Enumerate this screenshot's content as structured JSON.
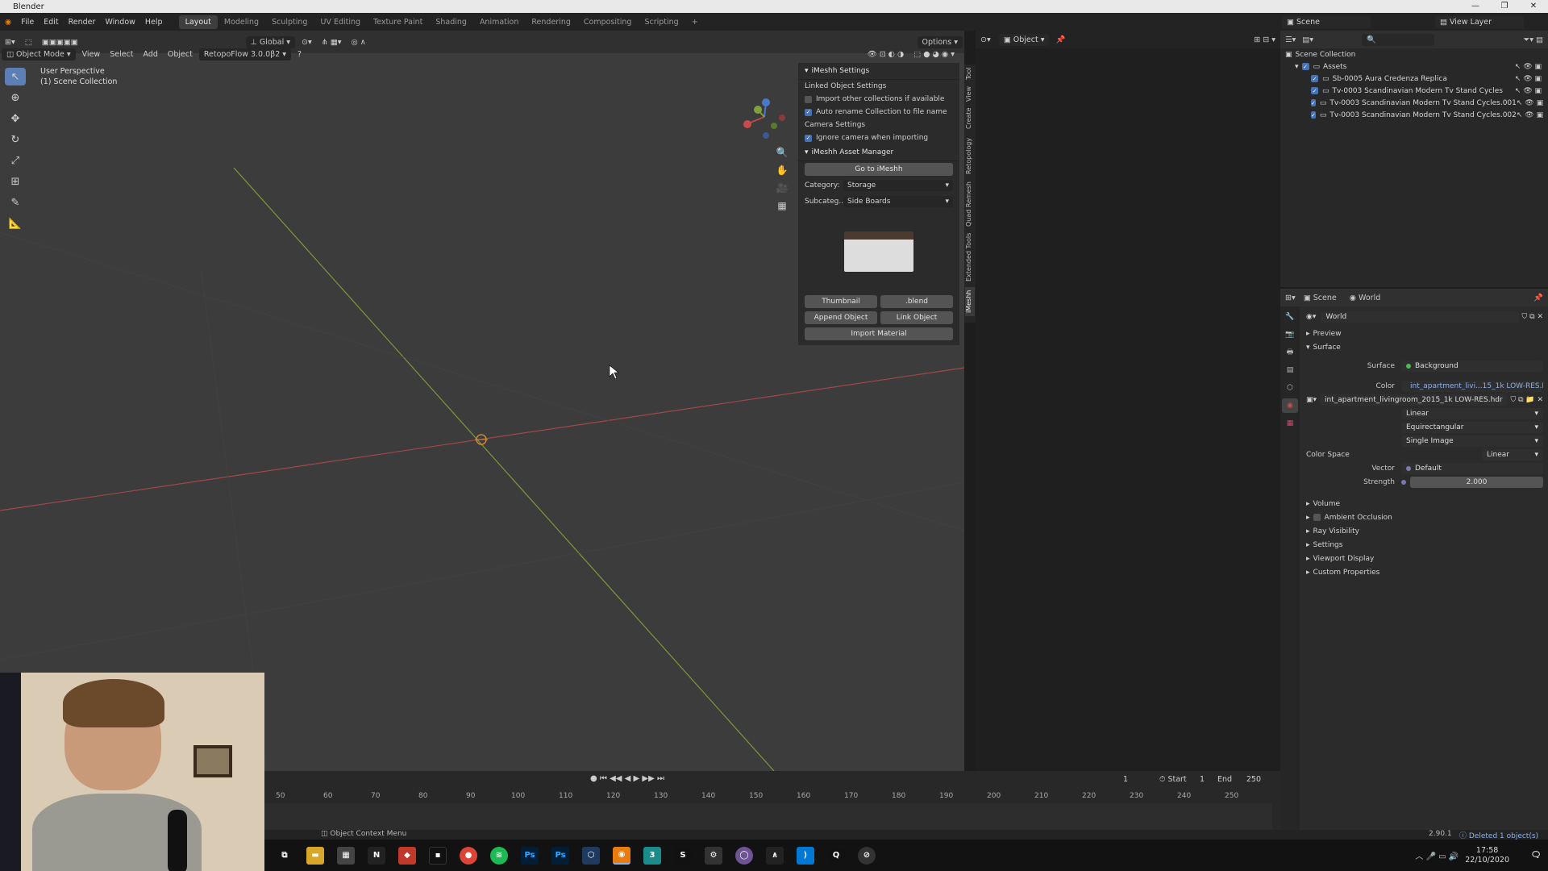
{
  "window": {
    "title": "Blender",
    "controls": [
      "—",
      "❐",
      "✕"
    ]
  },
  "menu": {
    "items": [
      "File",
      "Edit",
      "Render",
      "Window",
      "Help"
    ]
  },
  "workspaces": [
    {
      "label": "Layout",
      "active": true
    },
    {
      "label": "Modeling"
    },
    {
      "label": "Sculpting"
    },
    {
      "label": "UV Editing"
    },
    {
      "label": "Texture Paint"
    },
    {
      "label": "Shading"
    },
    {
      "label": "Animation"
    },
    {
      "label": "Rendering"
    },
    {
      "label": "Compositing"
    },
    {
      "label": "Scripting"
    },
    {
      "label": "+"
    }
  ],
  "top_right": {
    "scene": "Scene",
    "view_layer": "View Layer"
  },
  "viewport": {
    "mode": "Object Mode",
    "menus": [
      "View",
      "Select",
      "Add",
      "Object"
    ],
    "addon": "RetopoFlow 3.0.0β2",
    "transform": "Global",
    "options": "Options",
    "info_line1": "User Perspective",
    "info_line2": "(1) Scene Collection"
  },
  "npanel": {
    "imeshh_settings": "iMeshh Settings",
    "linked_object_settings": "Linked Object Settings",
    "import_other": "Import other collections if available",
    "auto_rename": "Auto rename Collection to file name",
    "camera_settings": "Camera Settings",
    "ignore_camera": "Ignore camera when importing",
    "asset_manager": "iMeshh Asset Manager",
    "go_to": "Go to iMeshh",
    "category_label": "Category:",
    "category_value": "Storage",
    "subcat_label": "Subcateg...",
    "subcat_value": "Side Boards",
    "thumbnail": "Thumbnail",
    "blend": ".blend",
    "append": "Append Object",
    "link": "Link Object",
    "import_material": "Import Material"
  },
  "vtabs": [
    "Tool",
    "View",
    "Create",
    "Retopology",
    "Quad Remesh",
    "Extended Tools",
    "iMeshh"
  ],
  "node_editor": {
    "mode": "Object"
  },
  "outliner": {
    "root": "Scene Collection",
    "collection": "Assets",
    "items": [
      "Sb-0005 Aura Credenza Replica",
      "Tv-0003 Scandinavian Modern Tv Stand Cycles",
      "Tv-0003 Scandinavian Modern Tv Stand Cycles.001",
      "Tv-0003 Scandinavian Modern Tv Stand Cycles.002"
    ]
  },
  "properties": {
    "scene": "Scene",
    "world": "World",
    "world_name": "World",
    "preview": "Preview",
    "surface": "Surface",
    "surface_label": "Surface",
    "surface_value": "Background",
    "color_label": "Color",
    "color_value": "int_apartment_livi...15_1k LOW-RES.hdr",
    "image_name": "int_apartment_livingroom_2015_1k LOW-RES.hdr",
    "interp": "Linear",
    "projection": "Equirectangular",
    "source": "Single Image",
    "color_space_label": "Color Space",
    "color_space_value": "Linear",
    "vector_label": "Vector",
    "vector_value": "Default",
    "strength_label": "Strength",
    "strength_value": "2.000",
    "panels": [
      "Volume",
      "Ambient Occlusion",
      "Ray Visibility",
      "Settings",
      "Viewport Display",
      "Custom Properties"
    ]
  },
  "timeline": {
    "current": "1",
    "start_label": "Start",
    "start": "1",
    "end_label": "End",
    "end": "250",
    "ticks": [
      "50",
      "60",
      "70",
      "80",
      "90",
      "100",
      "110",
      "120",
      "130",
      "140",
      "150",
      "160",
      "170",
      "180",
      "190",
      "200",
      "210",
      "220",
      "230",
      "240",
      "250"
    ]
  },
  "status": {
    "context": "Object Context Menu",
    "version": "2.90.1",
    "message": "Deleted 1 object(s)"
  },
  "taskbar": {
    "time": "17:58",
    "date": "22/10/2020"
  },
  "colors": {
    "accent": "#4772b3",
    "x_axis": "#a04848",
    "y_axis": "#7a9a3a",
    "viewport_bg": "#3c3c3c"
  }
}
